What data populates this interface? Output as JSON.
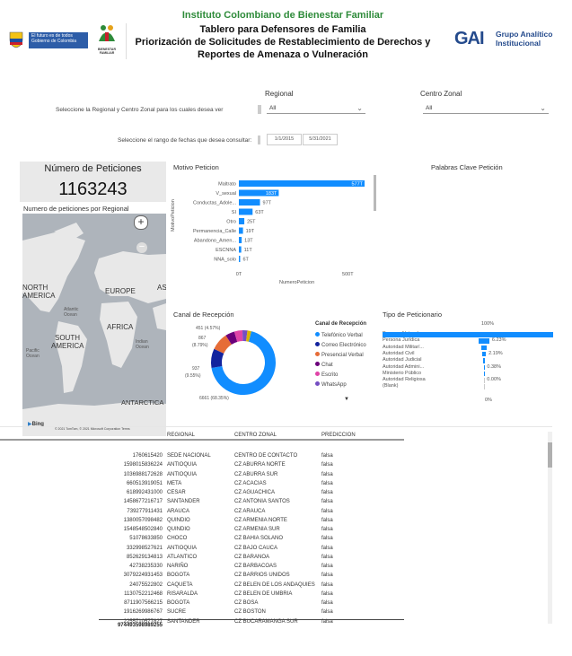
{
  "header": {
    "logo_gov_text": "El futuro es de todos",
    "logo_gov_text2": "Gobierno de Colombia",
    "icbf_text": "BIENESTAR FAMILIAR",
    "org": "Instituto Colombiano de Bienestar Familiar",
    "title_line1": "Tablero para Defensores de Familia",
    "title_line2": "Priorización de Solicitudes de Restablecimiento de Derechos y",
    "title_line3": "Reportes de Amenaza o Vulneración",
    "gai_mark": "GAI",
    "gai_line1": "Grupo Analítico",
    "gai_line2": "Institucional"
  },
  "filters": {
    "regional_label": "Regional",
    "centro_label": "Centro Zonal",
    "select_prompt": "Seleccione la Regional y Centro Zonal para los cuales desea ver",
    "regional_value": "All",
    "centro_value": "All",
    "date_prompt": "Seleccione el rango de fechas que desea consultar:",
    "date_from": "1/1/2015",
    "date_to": "5/31/2021"
  },
  "kpi": {
    "title": "Número de Peticiones",
    "value": "1163243"
  },
  "map": {
    "title": "Numero de peticiones por Regional",
    "labels": [
      "NORTH",
      "AMERICA",
      "EUROPE",
      "AFRICA",
      "SOUTH",
      "AMERICA",
      "ANTARCTICA",
      "ASI"
    ],
    "small_labels": [
      "Atlantic Ocean",
      "Pacific Ocean",
      "Indian Ocean"
    ],
    "copyright": "© 2021 TomTom, © 2021 Microsoft Corporation  Terms",
    "bing": "Bing"
  },
  "motivo": {
    "title": "Motivo Peticion",
    "ylabel": "MotivoPeticion",
    "xlabel": "NumeroPeticion",
    "ticks": [
      "0T",
      "500T"
    ],
    "bars": [
      {
        "label": "Maltrato",
        "value_label": "577T",
        "value": 577
      },
      {
        "label": "V_sexual",
        "value_label": "183T",
        "value": 183
      },
      {
        "label": "Conductas_Adole...",
        "value_label": "97T",
        "value": 97
      },
      {
        "label": "SI",
        "value_label": "63T",
        "value": 63
      },
      {
        "label": "Otro",
        "value_label": "25T",
        "value": 25
      },
      {
        "label": "Permanencia_Calle",
        "value_label": "19T",
        "value": 19
      },
      {
        "label": "Abandono_Amen...",
        "value_label": "13T",
        "value": 13
      },
      {
        "label": "ESCNNA",
        "value_label": "11T",
        "value": 11
      },
      {
        "label": "NNA_solo",
        "value_label": "6T",
        "value": 6
      }
    ]
  },
  "palabras": {
    "title": "Palabras Clave Petición"
  },
  "canal": {
    "title": "Canal de Recepción",
    "legend_title": "Canal de Recepción",
    "legend": [
      {
        "name": "Telefónico Verbal",
        "color": "#118DFF"
      },
      {
        "name": "Correo Electrónico",
        "color": "#12239E"
      },
      {
        "name": "Presencial Verbal",
        "color": "#E66C37"
      },
      {
        "name": "Chat",
        "color": "#6B007B"
      },
      {
        "name": "Escrito",
        "color": "#E044A7"
      },
      {
        "name": "WhatsApp",
        "color": "#744EC2"
      }
    ],
    "labels": [
      "451 (4.57%)",
      "867",
      "(8.79%)",
      "937",
      "(9.55%)",
      "6661 (68.35%)"
    ],
    "slices": [
      {
        "name": "Telefónico Verbal",
        "value": 6661,
        "color": "#118DFF"
      },
      {
        "name": "Correo Electrónico",
        "value": 937,
        "color": "#12239E"
      },
      {
        "name": "Presencial Verbal",
        "value": 867,
        "color": "#E66C37"
      },
      {
        "name": "Chat",
        "value": 451,
        "color": "#6B007B"
      },
      {
        "name": "Escrito",
        "value": 400,
        "color": "#E044A7"
      },
      {
        "name": "WhatsApp",
        "value": 240,
        "color": "#744EC2"
      },
      {
        "name": "otros",
        "value": 190,
        "color": "#D9B300"
      }
    ]
  },
  "tipo": {
    "title": "Tipo de Peticionario",
    "top_label": "100%",
    "rows": [
      {
        "label": "Persona Natural",
        "pct": 100,
        "text": ""
      },
      {
        "label": "Persona Jurídica",
        "pct": 6.23,
        "text": "6.23%"
      },
      {
        "label": "Autoridad Militar/...",
        "pct": 3.2,
        "text": ""
      },
      {
        "label": "Autoridad Civil",
        "pct": 2.19,
        "text": "2.19%"
      },
      {
        "label": "Autoridad Judicial",
        "pct": 0.9,
        "text": ""
      },
      {
        "label": "Autoridad Admini...",
        "pct": 0.38,
        "text": "0.38%"
      },
      {
        "label": "Ministerio Público",
        "pct": 0.15,
        "text": ""
      },
      {
        "label": "Autoridad Religiosa",
        "pct": 0,
        "text": "0.00%"
      },
      {
        "label": "(Blank)",
        "pct": 0,
        "text": ""
      }
    ],
    "bottom_label": "0%"
  },
  "table": {
    "headers": [
      "REGIONAL",
      "CENTRO ZONAL",
      "PREDICCION"
    ],
    "rows": [
      [
        "1760615420",
        "SEDE NACIONAL",
        "CENTRO DE CONTACTO",
        "falsa"
      ],
      [
        "1598015836224",
        "ANTIOQUIA",
        "CZ ABURRA NORTE",
        "falsa"
      ],
      [
        "1036988172628",
        "ANTIOQUIA",
        "CZ ABURRA SUR",
        "falsa"
      ],
      [
        "660513919051",
        "META",
        "CZ ACACIAS",
        "falsa"
      ],
      [
        "618992431000",
        "CESAR",
        "CZ AGUACHICA",
        "falsa"
      ],
      [
        "1458677216717",
        "SANTANDER",
        "CZ ANTONIA SANTOS",
        "falsa"
      ],
      [
        "739277911431",
        "ARAUCA",
        "CZ ARAUCA",
        "falsa"
      ],
      [
        "1380057098482",
        "QUINDIO",
        "CZ ARMENIA NORTE",
        "falsa"
      ],
      [
        "1548548502840",
        "QUINDIO",
        "CZ ARMENIA SUR",
        "falsa"
      ],
      [
        "51078633850",
        "CHOCO",
        "CZ BAHIA SOLANO",
        "falsa"
      ],
      [
        "332998527621",
        "ANTIOQUIA",
        "CZ BAJO CAUCA",
        "falsa"
      ],
      [
        "852629134813",
        "ATLANTICO",
        "CZ BARANOA",
        "falsa"
      ],
      [
        "42738235330",
        "NARIÑO",
        "CZ BARBACOAS",
        "falsa"
      ],
      [
        "3079224931453",
        "BOGOTA",
        "CZ BARRIOS UNIDOS",
        "falsa"
      ],
      [
        "24075522802",
        "CAQUETA",
        "CZ BELEN DE LOS ANDAQUIES",
        "falsa"
      ],
      [
        "1130752212468",
        "RISARALDA",
        "CZ BELEN DE UMBRIA",
        "falsa"
      ],
      [
        "8711907566215",
        "BOGOTA",
        "CZ BOSA",
        "falsa"
      ],
      [
        "1916269986767",
        "SUCRE",
        "CZ BOSTON",
        "falsa"
      ],
      [
        "2255710577827",
        "SANTANDER",
        "CZ BUCARAMANGA SUR",
        "falsa"
      ]
    ],
    "total": "974493598989255"
  }
}
